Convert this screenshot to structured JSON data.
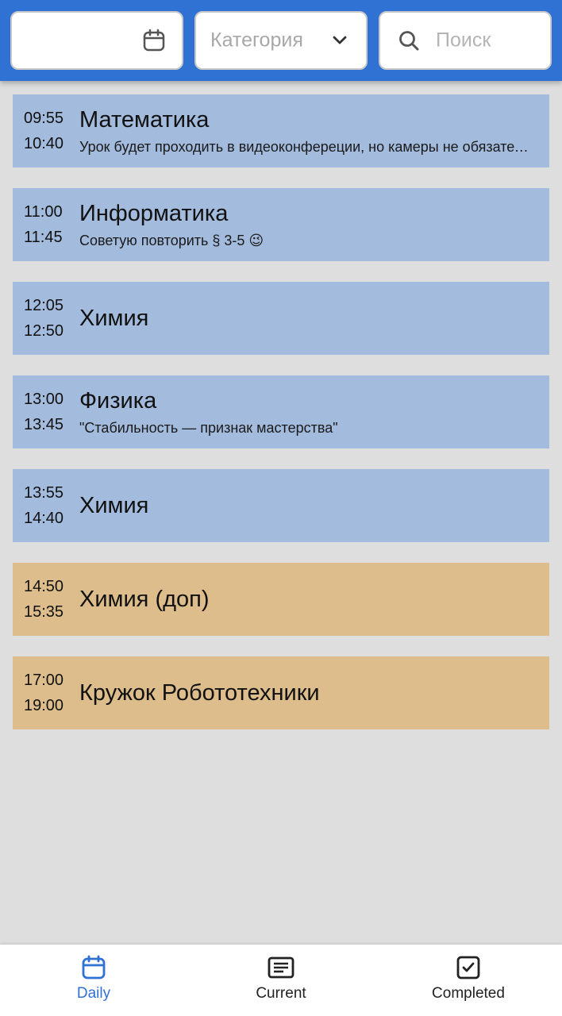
{
  "header": {
    "date_value": "",
    "category_placeholder": "Категория",
    "search_placeholder": "Поиск",
    "accent_color": "#2f72d3"
  },
  "lessons": [
    {
      "start": "09:55",
      "end": "10:40",
      "title": "Математика",
      "note": "Урок будет проходить в видеоконфереции, но камеры не обязательны",
      "kind": "regular"
    },
    {
      "start": "11:00",
      "end": "11:45",
      "title": "Информатика",
      "note": "Советую повторить § 3-5 😉",
      "kind": "regular"
    },
    {
      "start": "12:05",
      "end": "12:50",
      "title": "Химия",
      "note": "",
      "kind": "regular"
    },
    {
      "start": "13:00",
      "end": "13:45",
      "title": "Физика",
      "note": "\"Стабильность — признак мастерства\"",
      "kind": "regular"
    },
    {
      "start": "13:55",
      "end": "14:40",
      "title": "Химия",
      "note": "",
      "kind": "regular"
    },
    {
      "start": "14:50",
      "end": "15:35",
      "title": "Химия (доп)",
      "note": "",
      "kind": "extra"
    },
    {
      "start": "17:00",
      "end": "19:00",
      "title": "Кружок Робототехники",
      "note": "",
      "kind": "extra"
    }
  ],
  "colors": {
    "regular_card": "#a3bbdd",
    "extra_card": "#dcbd8b",
    "background": "#dedede"
  },
  "nav": {
    "items": [
      {
        "label": "Daily",
        "icon": "calendar-icon",
        "active": true
      },
      {
        "label": "Current",
        "icon": "list-icon",
        "active": false
      },
      {
        "label": "Completed",
        "icon": "checkbox-icon",
        "active": false
      }
    ]
  }
}
